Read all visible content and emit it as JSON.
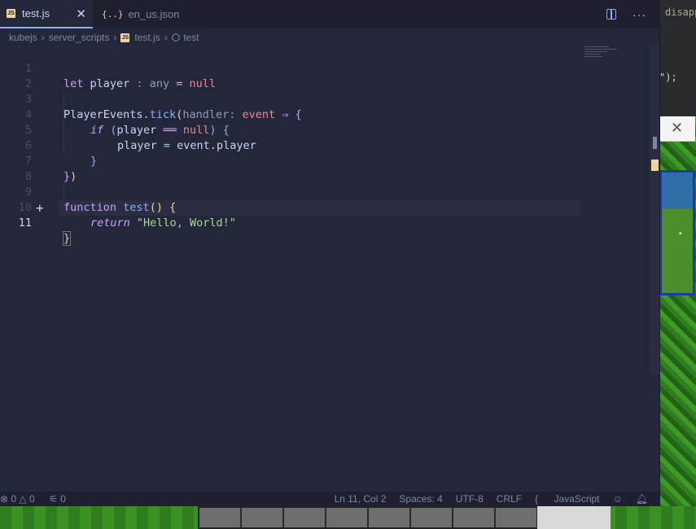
{
  "tabs": [
    {
      "label": "test.js",
      "icon": "js-icon",
      "active": true
    },
    {
      "label": "en_us.json",
      "icon": "json-braces-icon",
      "active": false
    }
  ],
  "tab_close_glyph": "✕",
  "breadcrumb": [
    "kubejs",
    "server_scripts",
    "test.js",
    "test"
  ],
  "code_lines": [
    {
      "n": "1"
    },
    {
      "n": "2"
    },
    {
      "n": "3"
    },
    {
      "n": "4"
    },
    {
      "n": "5"
    },
    {
      "n": "6"
    },
    {
      "n": "7"
    },
    {
      "n": "8"
    },
    {
      "n": "9"
    },
    {
      "n": "10"
    },
    {
      "n": "11"
    }
  ],
  "code": {
    "l1": {
      "kw": "let",
      "var": "player",
      "sep": " : ",
      "type": "any",
      "eq": " = ",
      "val": "null"
    },
    "l3": {
      "obj": "PlayerEvents",
      "dot": ".",
      "method": "tick",
      "open": "(",
      "hint": "handler:",
      "param": "event",
      "arrow": " ⇒ ",
      "brace": "{"
    },
    "l4": {
      "kw": "if",
      "open": " (",
      "var": "player",
      "op": " ══ ",
      "val": "null",
      "close": ")",
      "brace": " {"
    },
    "l5": {
      "lhs": "player",
      "eq": " = ",
      "rhs": "event.player"
    },
    "l6": {
      "brace": "}"
    },
    "l7": {
      "brace": "}",
      "paren": ")"
    },
    "l9": {
      "kw": "function",
      "name": "test",
      "parens": "()",
      "brace": " {"
    },
    "l10": {
      "kw": "return",
      "str": "\"Hello, World!\""
    },
    "l11": {
      "brace": "}"
    }
  },
  "status": {
    "errors": "⊗ 0",
    "warnings": "△ 0",
    "ports": "0",
    "position": "Ln 11, Col 2",
    "spaces": "Spaces: 4",
    "encoding": "UTF-8",
    "eol": "CRLF",
    "language": "JavaScript"
  },
  "background": {
    "peek_word": "disapp",
    "peek_punct": "\");",
    "popup_close": "✕"
  },
  "colors": {
    "editor_bg": "#24273a",
    "tab_active_border": "#8aadf4",
    "keyword": "#c6a0f6",
    "string": "#a6da95",
    "function": "#8aadf4",
    "null": "#ed8796"
  }
}
